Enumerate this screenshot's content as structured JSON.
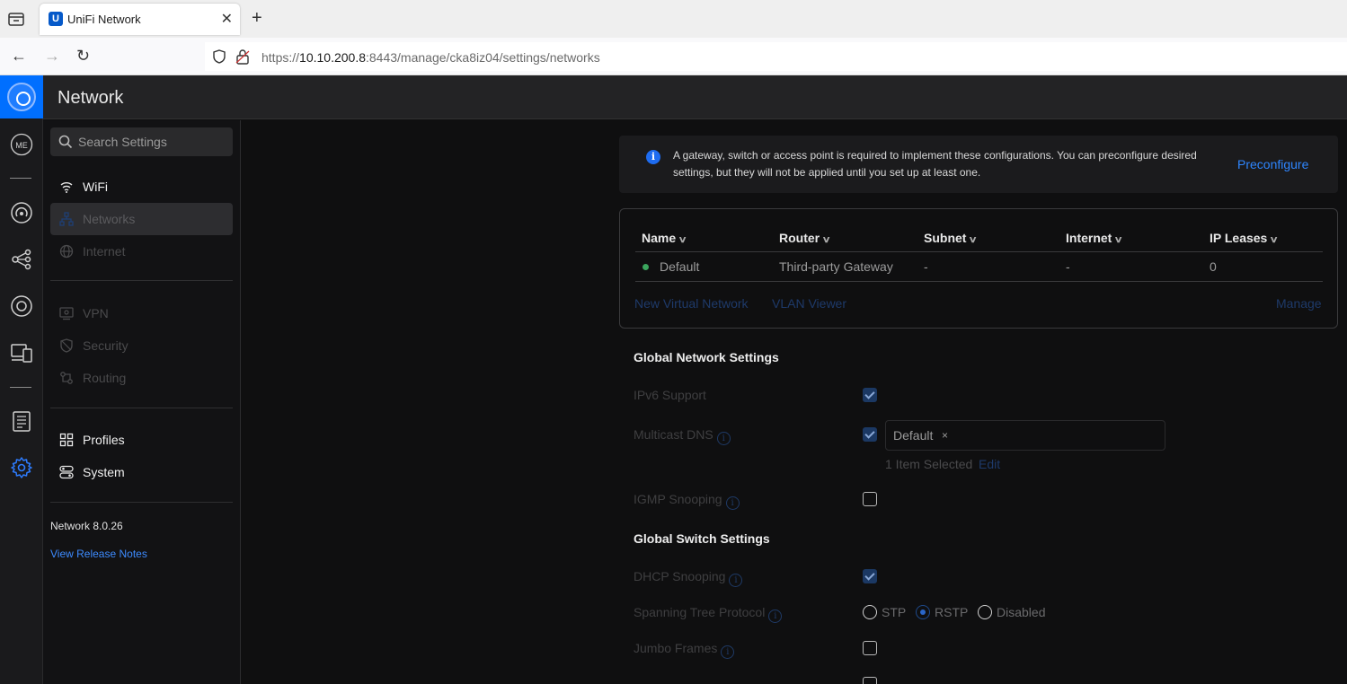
{
  "browser": {
    "tab_title": "UniFi Network",
    "url_prefix": "https://",
    "url_host": "10.10.200.8",
    "url_rest": ":8443/manage/cka8iz04/settings/networks"
  },
  "app": {
    "header_title": "Network",
    "rail": {
      "me_label": "ME"
    }
  },
  "sidebar": {
    "search_placeholder": "Search Settings",
    "items": [
      {
        "label": "WiFi"
      },
      {
        "label": "Networks"
      },
      {
        "label": "Internet"
      },
      {
        "label": "VPN"
      },
      {
        "label": "Security"
      },
      {
        "label": "Routing"
      },
      {
        "label": "Profiles"
      },
      {
        "label": "System"
      }
    ],
    "version": "Network 8.0.26",
    "release_notes": "View Release Notes"
  },
  "notice": {
    "text": "A gateway, switch or access point is required to implement these configurations. You can preconfigure desired settings, but they will not be applied until you set up at least one.",
    "action": "Preconfigure"
  },
  "networks_table": {
    "columns": [
      "Name",
      "Router",
      "Subnet",
      "Internet",
      "IP Leases"
    ],
    "rows": [
      {
        "name": "Default",
        "router": "Third-party Gateway",
        "subnet": "-",
        "internet": "-",
        "ip_leases": "0",
        "status_color": "#3ba55d"
      }
    ],
    "links": {
      "new_virtual": "New Virtual Network",
      "vlan_viewer": "VLAN Viewer",
      "manage": "Manage"
    }
  },
  "global_network": {
    "title": "Global Network Settings",
    "ipv6_label": "IPv6 Support",
    "ipv6_checked": true,
    "mdns_label": "Multicast DNS",
    "mdns_checked": true,
    "mdns_chip": "Default",
    "mdns_chip_remove": "×",
    "mdns_selected": "1 Item Selected",
    "mdns_edit": "Edit",
    "igmp_label": "IGMP Snooping",
    "igmp_checked": false
  },
  "global_switch": {
    "title": "Global Switch Settings",
    "dhcp_label": "DHCP Snooping",
    "dhcp_checked": true,
    "stp_label": "Spanning Tree Protocol",
    "stp_options": [
      "STP",
      "RSTP",
      "Disabled"
    ],
    "stp_selected": "RSTP",
    "jumbo_label": "Jumbo Frames",
    "jumbo_checked": false
  },
  "info_glyph": "i",
  "colors": {
    "accent": "#006fff",
    "link": "#2e86ff",
    "status_ok": "#3ba55d"
  }
}
